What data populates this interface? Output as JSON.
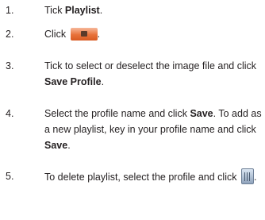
{
  "steps": [
    {
      "number": "1.",
      "parts": [
        "Tick ",
        "Playlist",
        "."
      ]
    },
    {
      "number": "2.",
      "parts": [
        "Click ",
        "."
      ],
      "icon": "save-playlist-button-icon"
    },
    {
      "number": "3.",
      "parts": [
        "Tick to select or deselect the image file and click ",
        "Save Profile",
        "."
      ]
    },
    {
      "number": "4.",
      "parts": [
        "Select the profile name and click ",
        "Save",
        ". To add as a new playlist, key in your profile name and click ",
        "Save",
        "."
      ]
    },
    {
      "number": "5.",
      "parts": [
        "To delete playlist, select the profile and click ",
        "."
      ],
      "icon": "trash-bin-icon"
    }
  ]
}
